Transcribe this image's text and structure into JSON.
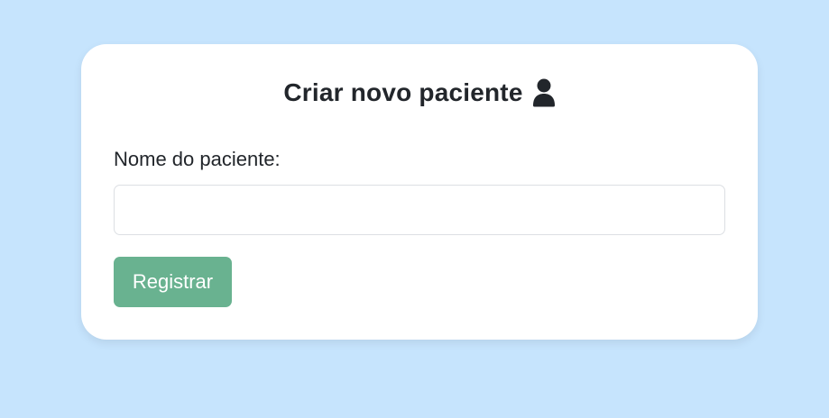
{
  "page": {
    "background": "#c6e4fd"
  },
  "form": {
    "title": "Criar novo paciente",
    "title_icon": "user-icon",
    "name_label": "Nome do paciente:",
    "name_value": "",
    "name_placeholder": "",
    "submit_label": "Registrar"
  },
  "colors": {
    "card": "#ffffff",
    "button": "#69b290",
    "text": "#22262b"
  }
}
